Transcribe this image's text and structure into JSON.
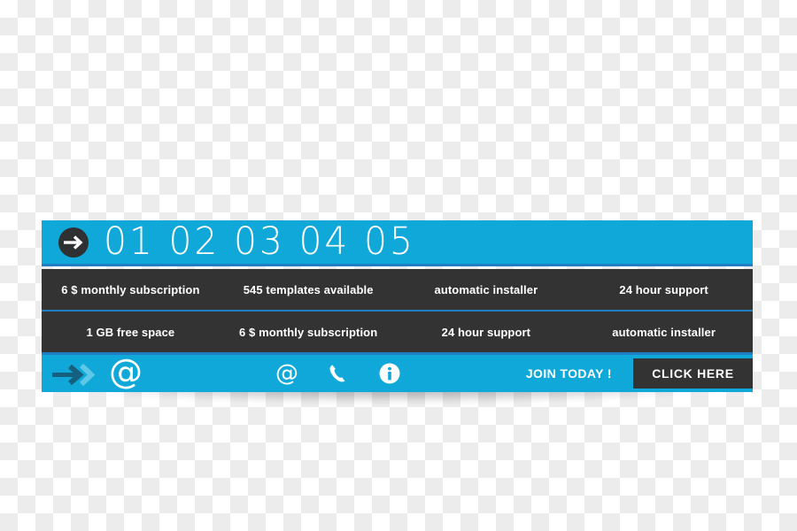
{
  "banner": {
    "colors": {
      "accent_blue": "#10a8d8",
      "separator_blue": "#1f7ec4",
      "dark_gray": "#333333",
      "text_white": "#ffffff"
    },
    "header": {
      "arrow_badge_icon": "arrow-right-circle-icon",
      "numbers": "01 02 03 04 05"
    },
    "feature_rows": [
      {
        "cells": [
          "6 $ monthly subscription",
          "545 templates available",
          "automatic installer",
          "24 hour support"
        ]
      },
      {
        "cells": [
          "1 GB free space",
          "6 $ monthly subscription",
          "24 hour support",
          "automatic installer"
        ]
      }
    ],
    "cta": {
      "arrow_chevrons_icon": "arrow-right-chevrons-icon",
      "at_symbol": "@",
      "icons": [
        {
          "name": "email-at-icon",
          "glyph": "@"
        },
        {
          "name": "phone-icon",
          "glyph": ""
        },
        {
          "name": "info-circle-icon",
          "glyph": ""
        }
      ],
      "join_label": "JOIN TODAY !",
      "button_label": "CLICK HERE"
    }
  }
}
